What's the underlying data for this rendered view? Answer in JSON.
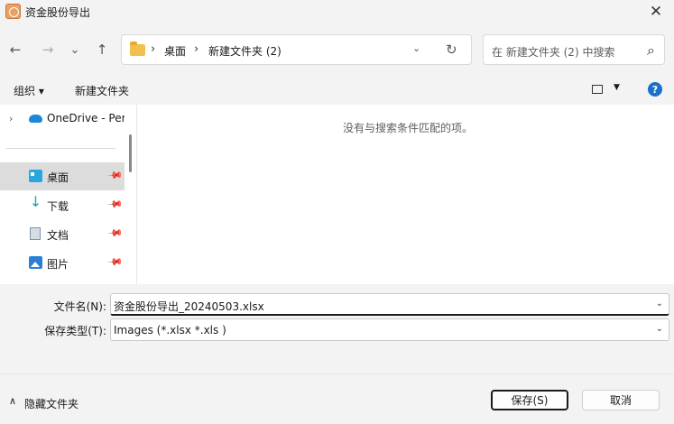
{
  "window": {
    "title": "资金股份导出",
    "close_label": "✕"
  },
  "nav": {
    "back": "←",
    "forward": "→",
    "recent": "⌄",
    "up": "↑",
    "address": {
      "crumbs": [
        "桌面",
        "新建文件夹 (2)"
      ],
      "sep": "›",
      "dropdown": "⌄",
      "refresh": "↻"
    },
    "search": {
      "placeholder": "在 新建文件夹 (2) 中搜索",
      "icon": "⌕"
    }
  },
  "toolbar": {
    "organize": "组织 ▾",
    "new_folder": "新建文件夹",
    "view_dd": "▼",
    "help": "?"
  },
  "sidebar": {
    "items": [
      {
        "label": "OneDrive - Per",
        "chev": "›"
      },
      {
        "label": "桌面",
        "pin": "📌"
      },
      {
        "label": "下载",
        "pin": "📌",
        "icon": "↓"
      },
      {
        "label": "文档",
        "pin": "📌"
      },
      {
        "label": "图片",
        "pin": "📌"
      }
    ]
  },
  "content": {
    "empty_message": "没有与搜索条件匹配的项。"
  },
  "fields": {
    "filename_label": "文件名(N):",
    "filename_value": "资金股份导出_20240503.xlsx",
    "filetype_label": "保存类型(T):",
    "filetype_value": "Images (*.xlsx *.xls )",
    "dropdown": "⌄"
  },
  "footer": {
    "hide_chev": "∧",
    "hide_folders": "隐藏文件夹",
    "save": "保存(S)",
    "cancel": "取消"
  }
}
